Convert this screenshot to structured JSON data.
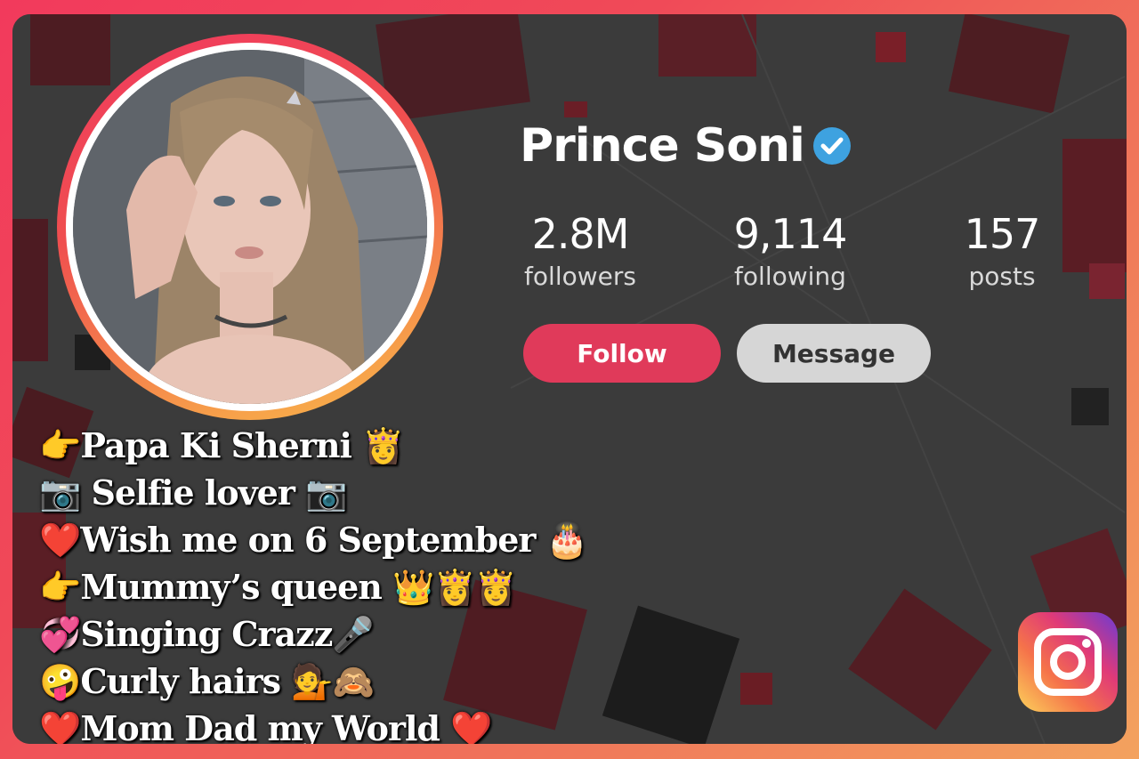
{
  "profile": {
    "name": "Prince Soni",
    "verified": true,
    "avatar": "profile-photo"
  },
  "stats": [
    {
      "value": "2.8M",
      "label": "followers"
    },
    {
      "value": "9,114",
      "label": "following"
    },
    {
      "value": "157",
      "label": "posts"
    }
  ],
  "actions": {
    "follow_label": "Follow",
    "message_label": "Message"
  },
  "bio": [
    "👉Papa Ki Sherni 👸",
    "📷 Selfie lover 📷",
    "❤️Wish me on 6 September 🎂",
    "👉Mummy’s queen 👑👸👸",
    "💞Singing Crazz🎤",
    "🤪Curly hairs 💁🙈",
    "❤️Mom Dad my World ❤️"
  ],
  "logo": "instagram-icon",
  "colors": {
    "follow_button": "#e03a5a",
    "message_button": "#d6d6d6",
    "verified_badge": "#3ea2e0",
    "card_background": "#3b3b3b",
    "frame_gradient_start": "#f23a5c",
    "frame_gradient_end": "#f3a25e"
  }
}
